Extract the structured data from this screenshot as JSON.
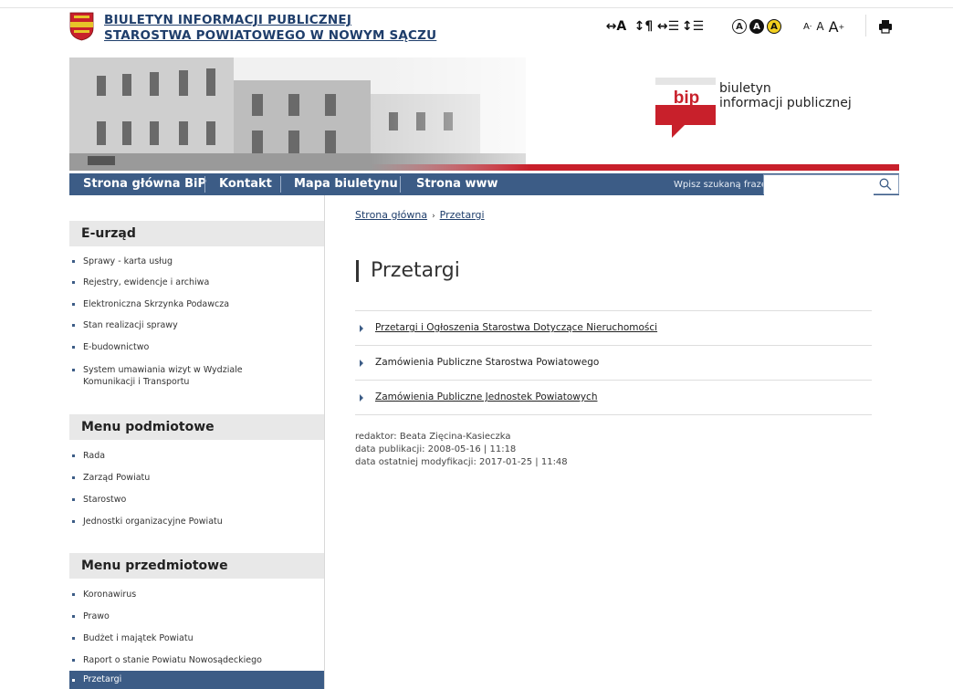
{
  "header": {
    "title_line1": "BIULETYN INFORMACJI PUBLICZNEJ",
    "title_line2": "STAROSTWA POWIATOWEGO W NOWYM SĄCZU"
  },
  "toolbar": {
    "text_spacing": "↔A",
    "paragraph_spacing": "↕¶",
    "letter_spacing": "↔☰",
    "line_height": "↕☰",
    "contrast_default": "A",
    "contrast_dark": "A",
    "contrast_yellow": "A",
    "font_small": "A",
    "font_small_sup": "-",
    "font_normal": "A",
    "font_large": "A",
    "font_large_sup": "+"
  },
  "banner": {
    "bip_logo_text": "bip",
    "bip_line1": "biuletyn",
    "bip_line2": "informacji publicznej"
  },
  "nav": {
    "items": [
      "Strona główna BiP",
      "Kontakt",
      "Mapa biuletynu",
      "Strona www"
    ],
    "search_label": "Wpisz szukaną frazę",
    "search_value": ""
  },
  "sidebar": {
    "sections": [
      {
        "title": "E-urząd",
        "items": [
          "Sprawy - karta usług",
          "Rejestry, ewidencje i archiwa",
          "Elektroniczna Skrzynka Podawcza",
          "Stan realizacji sprawy",
          "E-budownictwo",
          "System umawiania wizyt w Wydziale Komunikacji i Transportu"
        ]
      },
      {
        "title": "Menu podmiotowe",
        "items": [
          "Rada",
          "Zarząd Powiatu",
          "Starostwo",
          "Jednostki organizacyjne Powiatu"
        ]
      },
      {
        "title": "Menu przedmiotowe",
        "items": [
          "Koronawirus",
          "Prawo",
          "Budżet i majątek Powiatu",
          "Raport o stanie Powiatu Nowosądeckiego",
          "Przetargi"
        ]
      }
    ]
  },
  "breadcrumb": {
    "home": "Strona główna",
    "separator": "›",
    "current": "Przetargi"
  },
  "main": {
    "title": "Przetargi",
    "links": [
      "Przetargi i Ogłoszenia Starostwa Dotyczące Nieruchomości",
      "Zamówienia Publiczne Starostwa Powiatowego",
      "Zamówienia Publiczne Jednostek Powiatowych"
    ],
    "meta": {
      "editor": "redaktor: Beata Zięcina-Kasieczka",
      "published": "data publikacji: 2008-05-16 | 11:18",
      "modified": "data ostatniej modyfikacji: 2017-01-25 | 11:48"
    }
  },
  "colors": {
    "nav_bg": "#3c5c86",
    "accent_red": "#c8202b",
    "title_blue": "#1f3e6b"
  }
}
